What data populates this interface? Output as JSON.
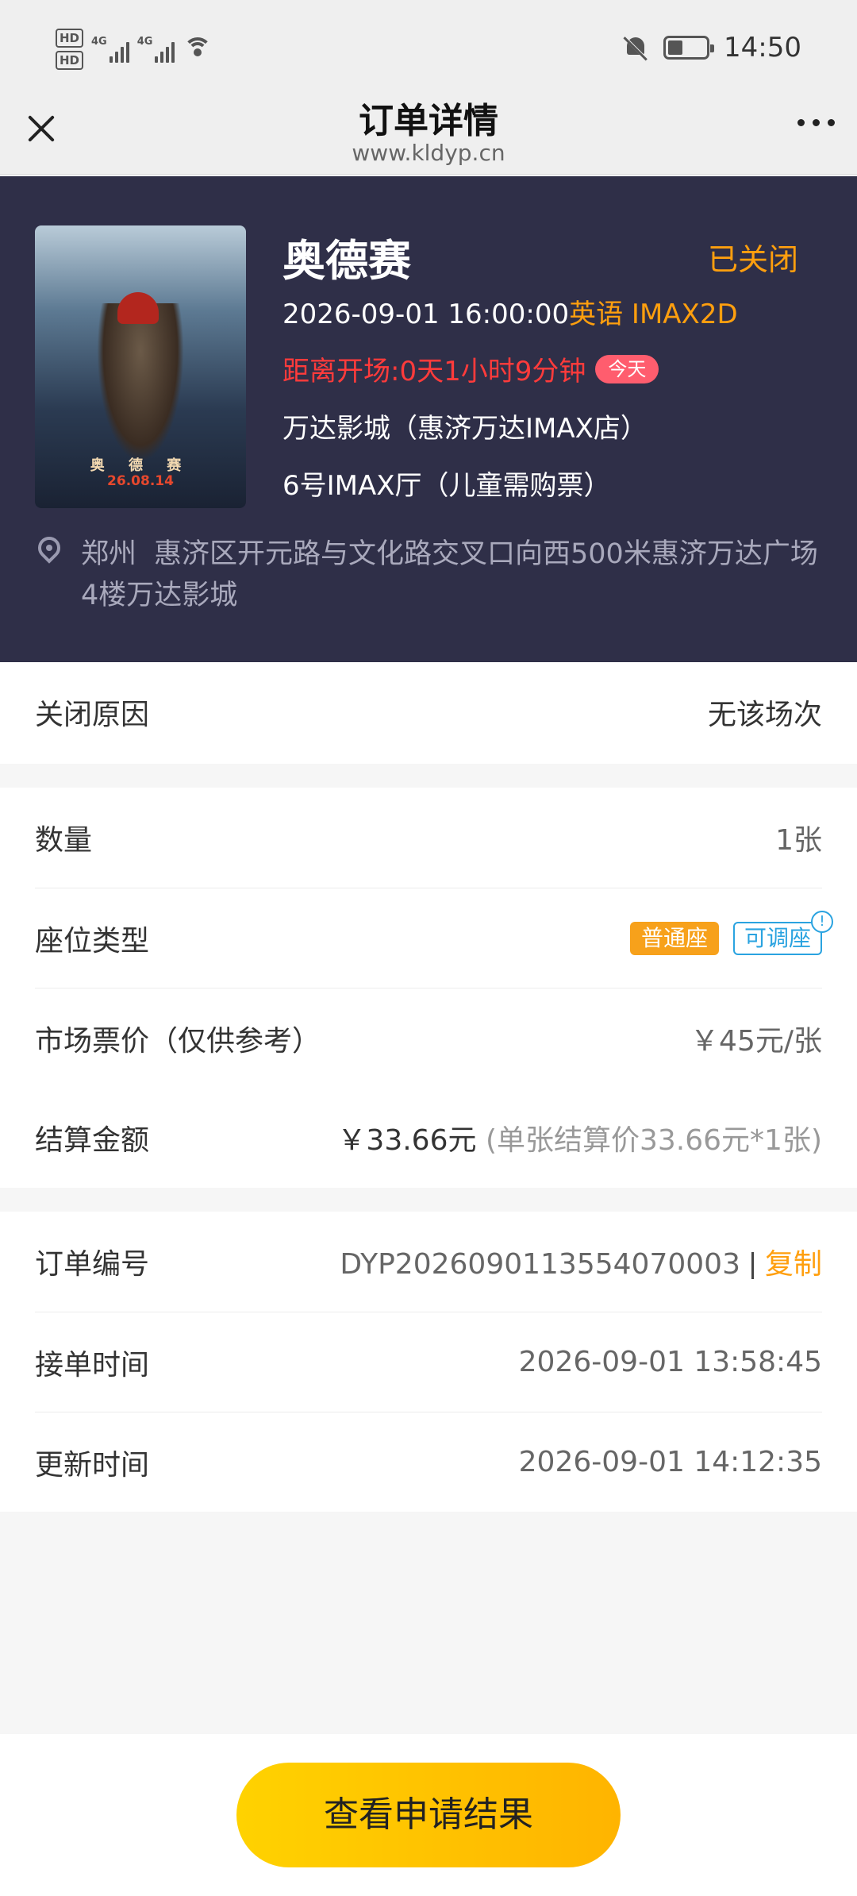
{
  "status_bar": {
    "sim1": "HD",
    "sim2": "HD",
    "net1": "4G",
    "net2": "4G",
    "time": "14:50"
  },
  "nav": {
    "title": "订单详情",
    "url": "www.kldyp.cn"
  },
  "movie": {
    "title": "奥德赛",
    "status": "已关闭",
    "showtime": "2026-09-01 16:00:00",
    "language_format": "英语 IMAX2D",
    "countdown": "距离开场:0天1小时9分钟",
    "today_badge": "今天",
    "cinema": "万达影城（惠济万达IMAX店）",
    "hall": "6号IMAX厅（儿童需购票）",
    "city": "郑州",
    "address": "惠济区开元路与文化路交叉口向西500米惠济万达广场4楼万达影城",
    "poster": {
      "title": "奥 德 赛",
      "date": "26.08.14"
    }
  },
  "close_reason": {
    "label": "关闭原因",
    "value": "无该场次"
  },
  "details": {
    "quantity_label": "数量",
    "quantity_value": "1张",
    "seat_type_label": "座位类型",
    "seat_type_normal": "普通座",
    "seat_type_adjustable": "可调座",
    "market_price_label": "市场票价（仅供参考）",
    "market_price_value": "￥45元/张",
    "settlement_label": "结算金额",
    "settlement_value": "￥33.66元",
    "settlement_note": "(单张结算价33.66元*1张)"
  },
  "order": {
    "number_label": "订单编号",
    "number_value": "DYP2026090113554070003",
    "copy_label": "复制",
    "accepted_label": "接单时间",
    "accepted_value": "2026-09-01 13:58:45",
    "updated_label": "更新时间",
    "updated_value": "2026-09-01 14:12:35"
  },
  "actions": {
    "view_result": "查看申请结果"
  },
  "colors": {
    "header_bg": "#2f2f48",
    "accent_orange": "#ff9f0e",
    "countdown_red": "#ff3b3b",
    "button_yellow": "#ffc800"
  }
}
